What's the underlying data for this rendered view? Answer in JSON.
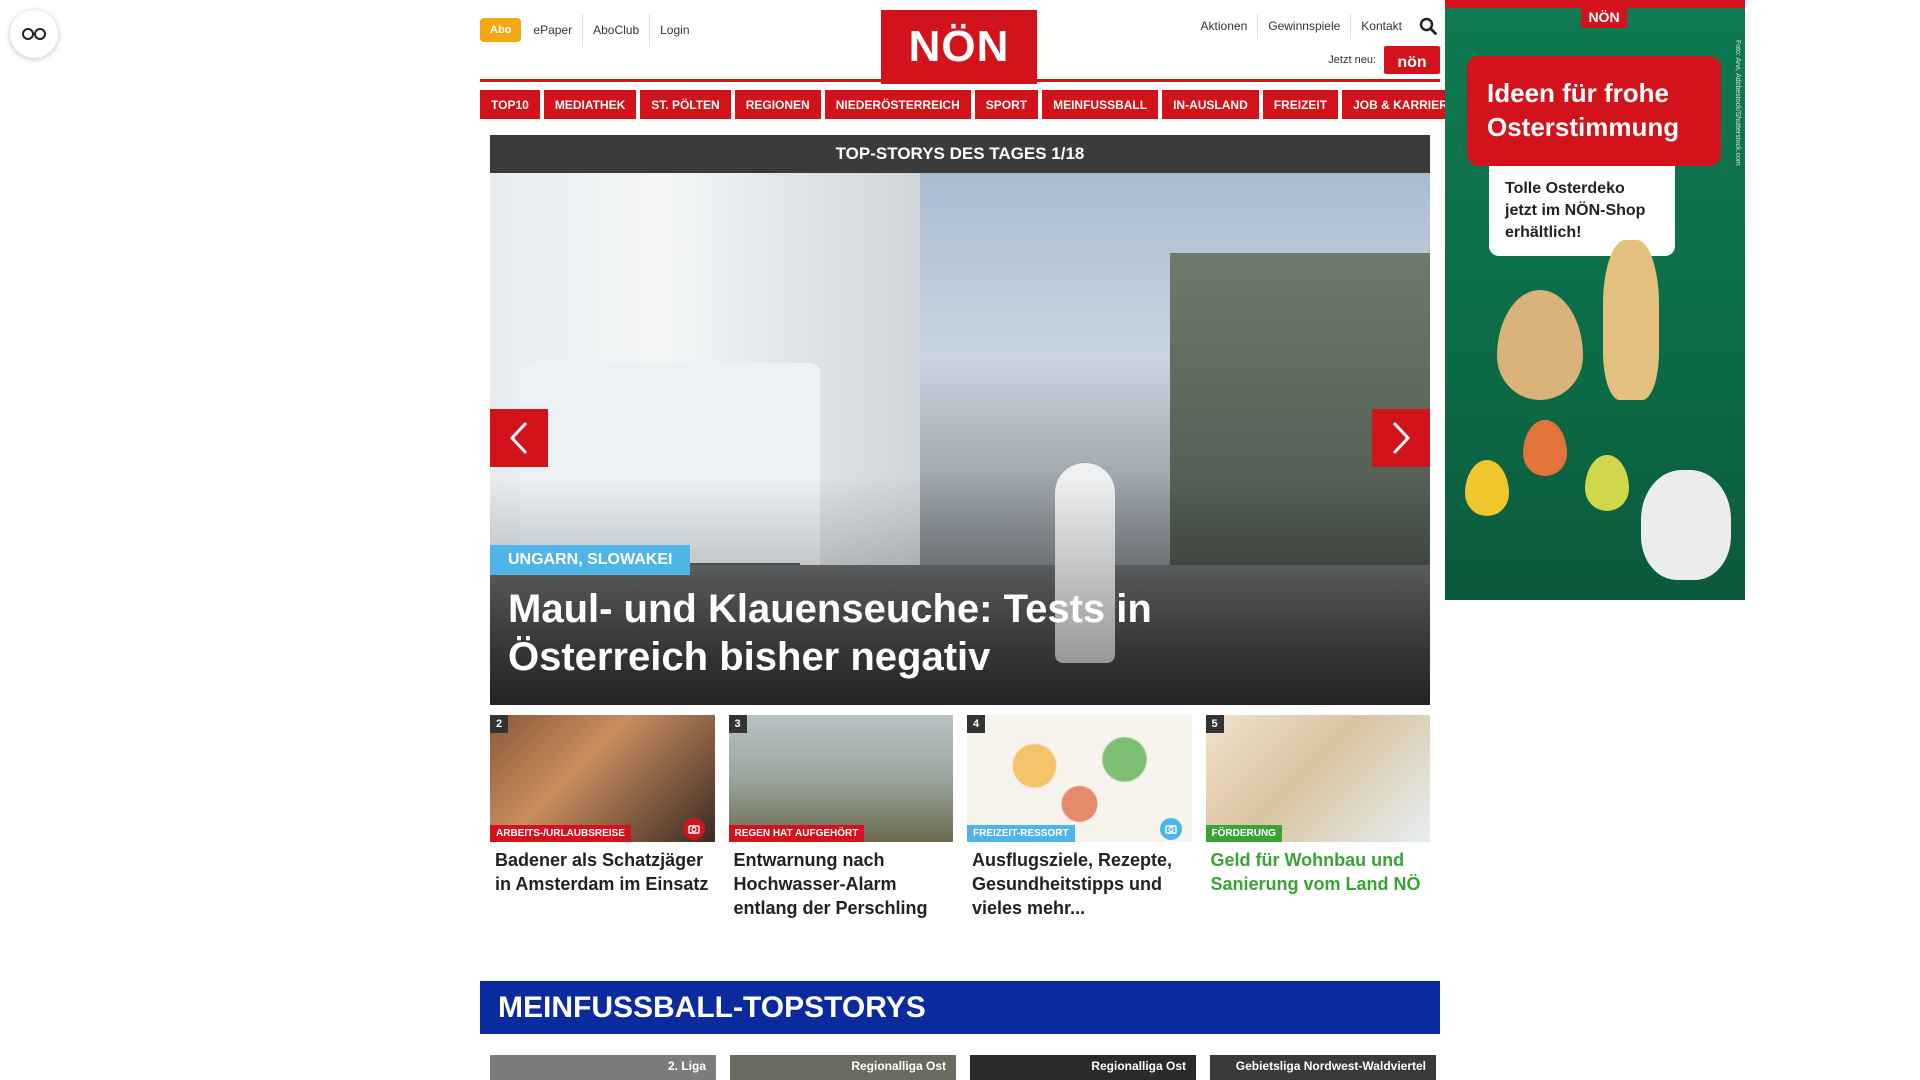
{
  "reader": {
    "icon": "glasses-icon"
  },
  "header": {
    "abo": "Abo",
    "links": [
      "ePaper",
      "AboClub",
      "Login"
    ],
    "logo": "NÖN",
    "right_links": [
      "Aktionen",
      "Gewinnspiele",
      "Kontakt"
    ],
    "jetzt_neu": "Jetzt neu:",
    "jetzt_logo": "nön"
  },
  "nav": [
    "TOP10",
    "MEDIATHEK",
    "ST. PÖLTEN",
    "REGIONEN",
    "NIEDERÖSTERREICH",
    "SPORT",
    "MEINFUSSBALL",
    "IN-AUSLAND",
    "FREIZEIT",
    "JOB & KARRIERE"
  ],
  "hero": {
    "bar_title": "TOP-STORYS DES TAGES 1/18",
    "tag": "UNGARN, SLOWAKEI",
    "headline": "Maul- und Klauenseuche: Tests in Österreich bisher negativ"
  },
  "teasers": [
    {
      "num": "2",
      "category": "ARBEITS-/URLAUBSREISE",
      "cat_color": "#d3131b",
      "title": "Badener als Schatzjäger in Amsterdam im Einsatz",
      "camera": true
    },
    {
      "num": "3",
      "category": "REGEN HAT AUFGEHÖRT",
      "cat_color": "#d3131b",
      "title": "Entwarnung nach Hochwasser-Alarm entlang der Perschling",
      "camera": false
    },
    {
      "num": "4",
      "category": "FREIZEIT-RESSORT",
      "cat_color": "#4fb4e8",
      "title": "Ausflugsziele, Rezepte, Gesundheitstipps und vieles mehr...",
      "camera": true
    },
    {
      "num": "5",
      "category": "FÖRDERUNG",
      "cat_color": "#3aa335",
      "title": "Geld für Wohnbau und Sanierung vom Land NÖ",
      "camera": false
    }
  ],
  "section": {
    "title": "MEINFUSSBALL-TOPSTORYS",
    "minis": [
      "2. Liga",
      "Regionalliga Ost",
      "Regionalliga Ost",
      "Gebietsliga Nordwest-Waldviertel"
    ]
  },
  "ad": {
    "logo": "NÖN",
    "headline_1": "Ideen für frohe",
    "headline_2": "Osterstimmung",
    "sub_1": "Tolle Osterdeko",
    "sub_2": "jetzt im NÖN-Shop",
    "sub_3": "erhältlich!",
    "credit": "Foto: Arvi, Adobestock/Shutterstock.com"
  }
}
